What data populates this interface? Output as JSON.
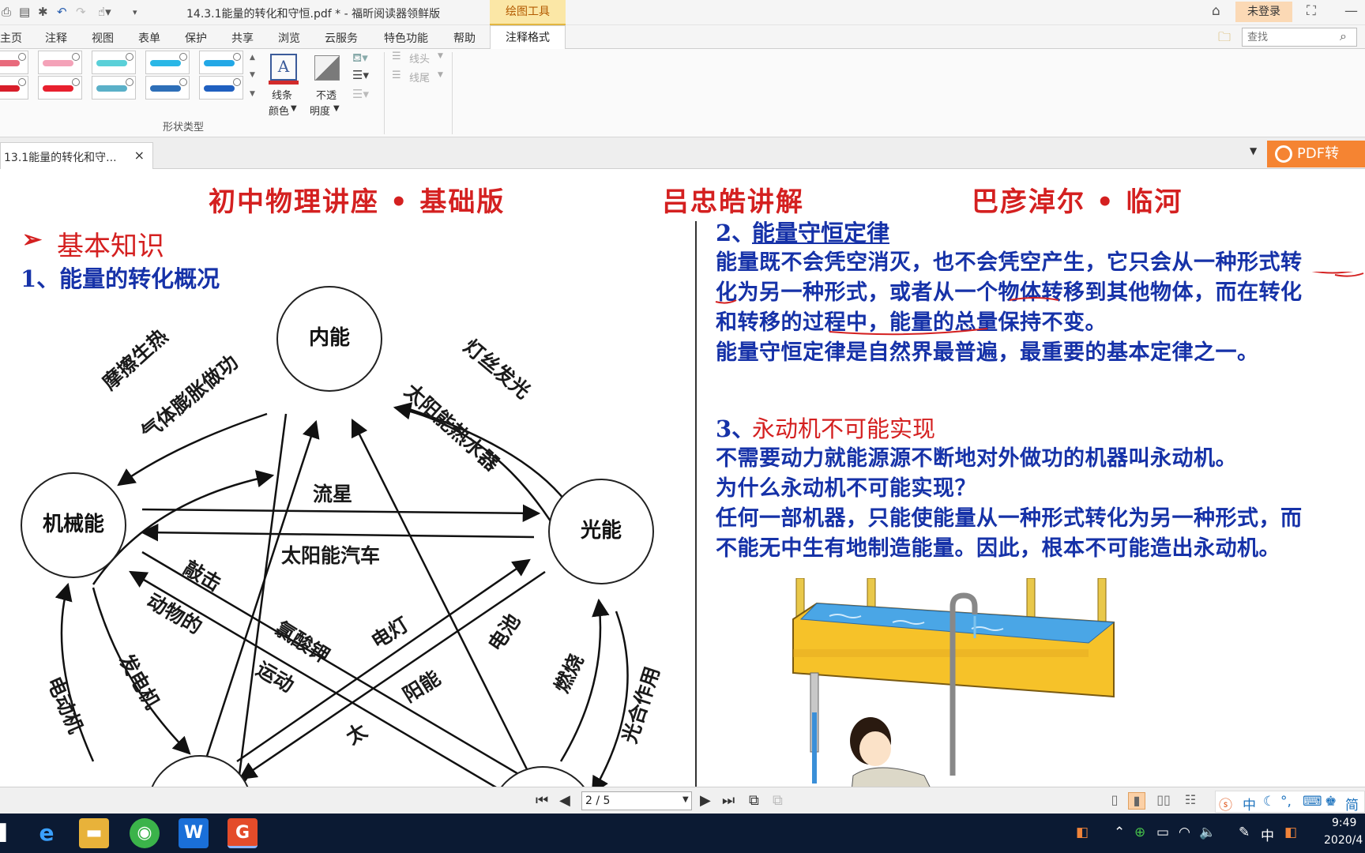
{
  "titlebar": {
    "doc_title": "14.3.1能量的转化和守恒.pdf * - 福昕阅读器领鲜版",
    "context_tab": "绘图工具",
    "login": "未登录"
  },
  "menu": {
    "tabs": [
      "主页",
      "注释",
      "视图",
      "表单",
      "保护",
      "共享",
      "浏览",
      "云服务",
      "特色功能",
      "帮助"
    ],
    "active_tab": "注释格式",
    "search_placeholder": "查找"
  },
  "ribbon": {
    "shape_group_label": "形状类型",
    "line_color_label_1": "线条",
    "line_color_label_2": "颜色",
    "opacity_label_1": "不透",
    "opacity_label_2": "明度",
    "line_head": "线头",
    "line_tail": "线尾",
    "swatches_top": [
      "#e86a7c",
      "#f4a2b8",
      "#5ad0d8",
      "#2ab7e6",
      "#23a8e6"
    ],
    "swatches_bottom": [
      "#d81e2a",
      "#e8202e",
      "#5ab0c8",
      "#2e6fb8",
      "#2060c0"
    ]
  },
  "doctab": {
    "label": "13.1能量的转化和守...",
    "close": "×",
    "pdf_convert": "PDF转"
  },
  "page": {
    "header_left": "初中物理讲座 • 基础版",
    "header_mid": "吕忠皓讲解",
    "header_right": "巴彦淖尔 • 临河",
    "basic_marker": "➢",
    "basic_title": "基本知识",
    "s1_title": "1、能量的转化概况",
    "s2_num": "2、",
    "s2_title": "能量守恒定律",
    "s2_lines": [
      "能量既不会凭空消灭，也不会凭空产生，它只会从一种形式转",
      "化为另一种形式，或者从一个物体转移到其他物体，而在转化",
      "和转移的过程中，能量的总量保持不变。",
      "能量守恒定律是自然界最普遍，最重要的基本定律之一。"
    ],
    "s3_num": "3、",
    "s3_title": "永动机不可能实现",
    "s3_lines": [
      "不需要动力就能源源不断地对外做功的机器叫永动机。",
      "为什么永动机不可能实现？",
      "任何一部机器，只能使能量从一种形式转化为另一种形式，而",
      "不能无中生有地制造能量。因此，根本不可能造出永动机。"
    ],
    "diagram": {
      "nodes": {
        "internal": "内能",
        "mechanical": "机械能",
        "light": "光能"
      },
      "labels": {
        "friction": "摩擦生热",
        "gas": "气体膨胀做功",
        "filament": "灯丝发光",
        "solar_heater": "太阳能热水器",
        "meteor": "流星",
        "solar_car": "太阳能汽车",
        "strike": "敲击",
        "animal": "动物的",
        "motion": "运动",
        "generator": "发电机",
        "motor": "电动机",
        "kclo3": "氯酸钾",
        "lamp": "电灯",
        "battery": "电池",
        "burning": "燃烧",
        "photosynthesis": "光合作用",
        "sun1": "阳能",
        "sun2": "太"
      }
    }
  },
  "statusbar": {
    "page_value": "2 / 5"
  },
  "ime": {
    "lang": "中",
    "simp": "简"
  },
  "taskbar": {
    "tray_lang": "中",
    "time": "9:49",
    "date": "2020/4"
  }
}
